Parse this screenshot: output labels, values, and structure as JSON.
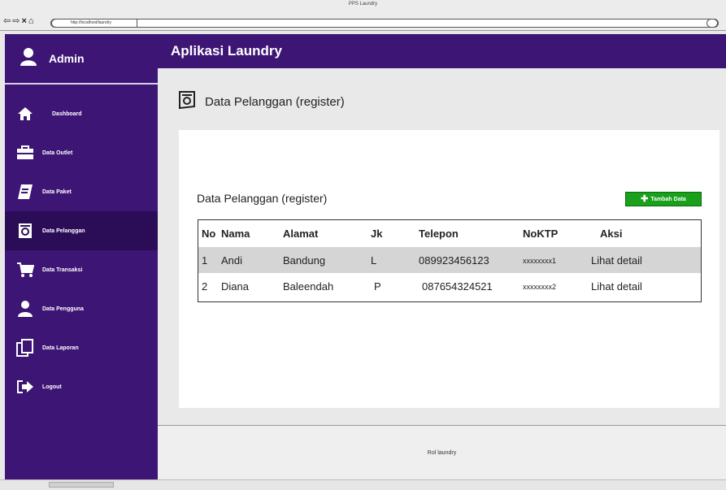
{
  "browser": {
    "window_title": "PPS Laundry",
    "url": "http://localhost/laundry"
  },
  "sidebar": {
    "user_label": "Admin",
    "items": [
      {
        "label": "Dashboard",
        "icon": "home-icon"
      },
      {
        "label": "Data Outlet",
        "icon": "briefcase-icon"
      },
      {
        "label": "Data Paket",
        "icon": "notebook-icon"
      },
      {
        "label": "Data Pelanggan",
        "icon": "badge-icon",
        "active": true
      },
      {
        "label": "Data Transaksi",
        "icon": "cart-icon"
      },
      {
        "label": "Data Pengguna",
        "icon": "user-icon"
      },
      {
        "label": "Data Laporan",
        "icon": "copy-icon"
      },
      {
        "label": "Logout",
        "icon": "logout-icon"
      }
    ]
  },
  "header": {
    "title": "Aplikasi Laundry"
  },
  "main": {
    "page_title": "Data Pelanggan (register)",
    "card_title": "Data Pelanggan (register)",
    "add_button_label": "Tambah Data",
    "table": {
      "columns": [
        "No",
        "Nama",
        "Alamat",
        "Jk",
        "Telepon",
        "NoKTP",
        "Aksi"
      ],
      "rows": [
        {
          "no": "1",
          "nama": "Andi",
          "alamat": "Bandung",
          "jk": "L",
          "telepon": "089923456123",
          "noktp": "xxxxxxxx1",
          "aksi": "Lihat detail"
        },
        {
          "no": "2",
          "nama": "Diana",
          "alamat": "Baleendah",
          "jk": "P",
          "telepon": "087654324521",
          "noktp": "xxxxxxxx2",
          "aksi": "Lihat detail"
        }
      ]
    }
  },
  "footer": {
    "text": "Rol laundry"
  },
  "colors": {
    "sidebar_bg": "#3d1575",
    "active_item_bg": "#2b0d57",
    "add_button_bg": "#1aa01a"
  }
}
